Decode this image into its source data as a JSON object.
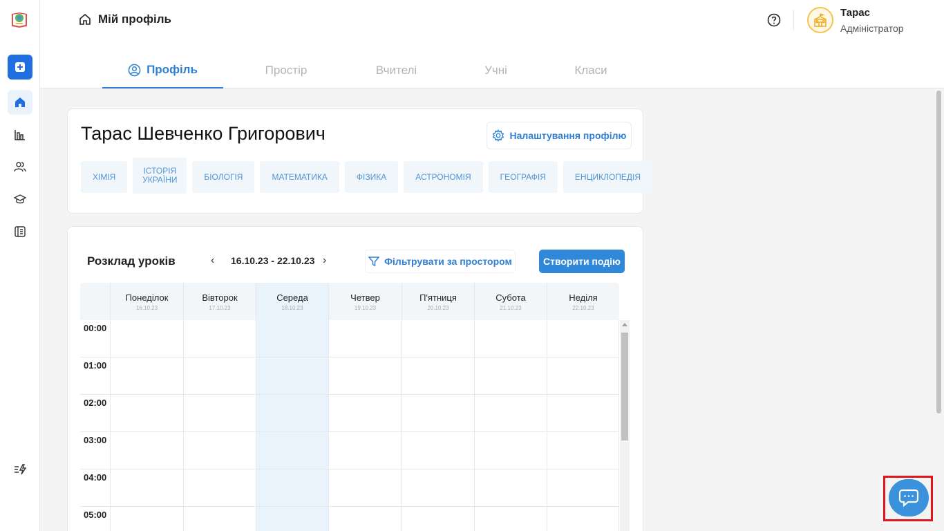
{
  "header": {
    "breadcrumb": "Мій профіль",
    "user_name": "Тарас",
    "user_role": "Адміністратор"
  },
  "tabs": [
    {
      "label": "Профіль",
      "active": true
    },
    {
      "label": "Простір",
      "active": false
    },
    {
      "label": "Вчителі",
      "active": false
    },
    {
      "label": "Учні",
      "active": false
    },
    {
      "label": "Класи",
      "active": false
    }
  ],
  "profile": {
    "name": "Тарас Шевченко Григорович",
    "settings_label": "Налаштування профілю",
    "subjects": [
      "ХІМІЯ",
      "ІСТОРІЯ УКРАЇНИ",
      "БІОЛОГІЯ",
      "МАТЕМАТИКА",
      "ФІЗИКА",
      "АСТРОНОМІЯ",
      "ГЕОГРАФІЯ",
      "ЕНЦИКЛОПЕДІЯ"
    ]
  },
  "schedule": {
    "title": "Розклад уроків",
    "prev": "‹",
    "next": "›",
    "range": "16.10.23 - 22.10.23",
    "filter_label": "Фільтрувати за простором",
    "create_label": "Створити подію",
    "days": [
      {
        "name": "Понеділок",
        "date": "16.10.23"
      },
      {
        "name": "Вівторок",
        "date": "17.10.23"
      },
      {
        "name": "Середа",
        "date": "18.10.23",
        "today": true
      },
      {
        "name": "Четвер",
        "date": "19.10.23"
      },
      {
        "name": "П'ятниця",
        "date": "20.10.23"
      },
      {
        "name": "Субота",
        "date": "21.10.23"
      },
      {
        "name": "Неділя",
        "date": "22.10.23"
      }
    ],
    "hours": [
      "00:00",
      "01:00",
      "02:00",
      "03:00",
      "04:00",
      "05:00"
    ]
  },
  "colors": {
    "accent": "#2f80d4",
    "primary_button": "#3288d8",
    "today_column": "#e8f3fc",
    "chat_highlight": "#e0161d"
  },
  "icons": {
    "sidebar": [
      "logo-icon",
      "add-icon",
      "home-icon",
      "chart-icon",
      "users-icon",
      "graduation-cap-icon",
      "book-icon",
      "lightning-icon"
    ],
    "header": [
      "home-icon",
      "help-icon",
      "school-icon"
    ],
    "chat": "chat-icon"
  }
}
